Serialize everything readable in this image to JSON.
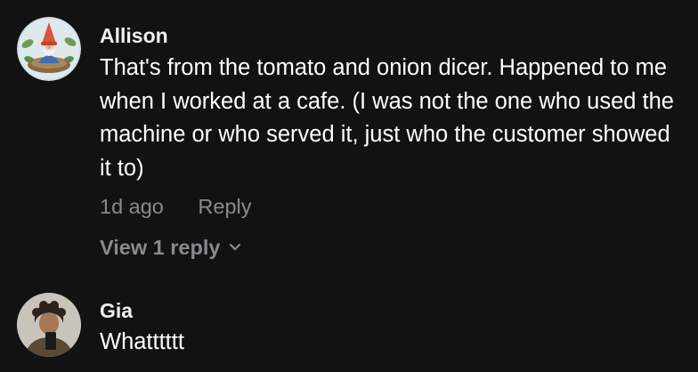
{
  "comments": [
    {
      "author": "Allison",
      "text": "That's from the tomato and onion dicer. Happened to me when I worked at a cafe. (I was not the one who used the machine or who served it, just who the customer showed it to)",
      "time": "1d ago",
      "reply_label": "Reply",
      "view_replies_label": "View 1 reply",
      "avatar_icon": "gnome-avatar-icon"
    },
    {
      "author": "Gia",
      "text": "Whatttttt",
      "avatar_icon": "person-avatar-icon"
    }
  ],
  "colors": {
    "background": "#121212",
    "text_primary": "#ffffff",
    "text_secondary": "#8a8a8e"
  }
}
